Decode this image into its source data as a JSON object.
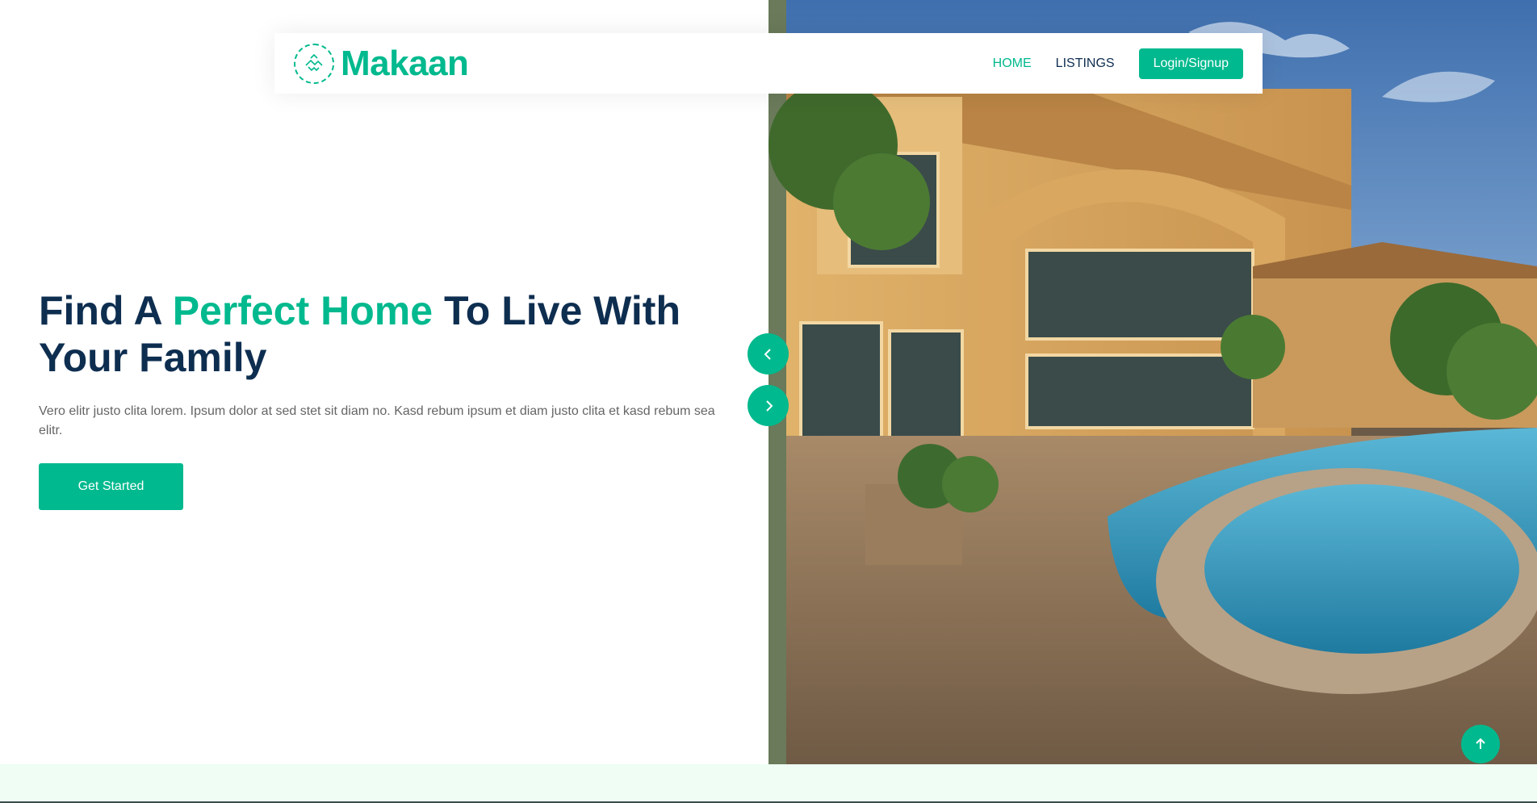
{
  "brand": {
    "name": "Makaan",
    "color": "#00B98E",
    "logo_icon": "handshake-house-icon"
  },
  "nav": {
    "items": [
      {
        "label": "HOME",
        "active": true
      },
      {
        "label": "LISTINGS",
        "active": false
      }
    ],
    "cta_label": "Login/Signup"
  },
  "hero": {
    "title_part1": "Find A ",
    "title_accent": "Perfect Home",
    "title_part2": " To Live With Your Family",
    "description": "Vero elitr justo clita lorem. Ipsum dolor at sed stet sit diam no. Kasd rebum ipsum et diam justo clita et kasd rebum sea elitr.",
    "button_label": "Get Started",
    "image_alt": "luxury house with pool at sunset"
  },
  "carousel": {
    "prev_icon": "chevron-left-icon",
    "next_icon": "chevron-right-icon"
  },
  "back_to_top_icon": "arrow-up-icon",
  "colors": {
    "primary": "#00B98E",
    "dark": "#0E2E50",
    "light_bg": "#EFFDF5"
  }
}
